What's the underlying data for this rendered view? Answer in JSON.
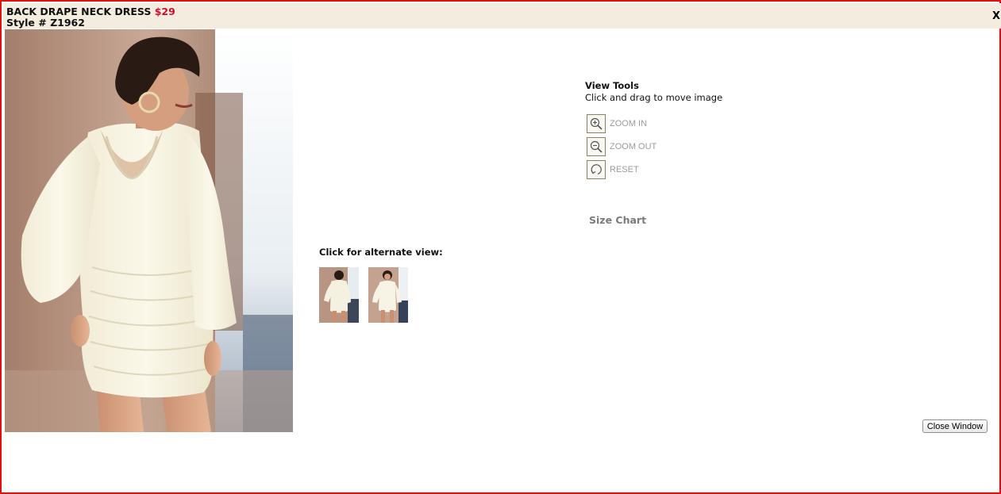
{
  "header": {
    "product_name": "BACK DRAPE NECK DRESS",
    "price": "$29",
    "style_line": "Style # Z1962",
    "close_label": "X"
  },
  "view_tools": {
    "title": "View Tools",
    "hint": "Click and drag to move image",
    "zoom_in": "ZOOM IN",
    "zoom_out": "ZOOM OUT",
    "reset": "RESET"
  },
  "size_chart_label": "Size Chart",
  "alternate": {
    "label": "Click for alternate view:"
  },
  "close_window_label": "Close Window",
  "colors": {
    "frame_border": "#e01010",
    "header_bg": "#f3ecdf",
    "price": "#c8102e",
    "tool_label": "#9b9b9b"
  },
  "icons": {
    "zoom_in": "magnifier-plus-icon",
    "zoom_out": "magnifier-minus-icon",
    "reset": "reset-arrow-icon"
  }
}
